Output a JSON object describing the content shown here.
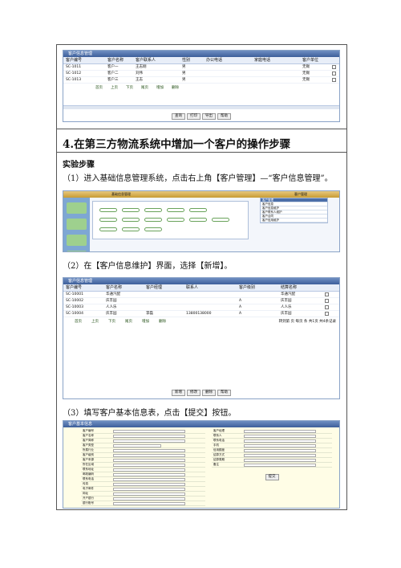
{
  "top_table": {
    "title": "客户信息管理",
    "headers": [
      "客户编号",
      "客户名称",
      "客户联系人",
      "性别",
      "办公电话",
      "家庭电话",
      "客户单位"
    ],
    "rows": [
      [
        "SC-1011",
        "客户一",
        "王志刚",
        "男",
        "",
        "",
        "无锡"
      ],
      [
        "SC-1012",
        "客户二",
        "刘伟",
        "男",
        "",
        "",
        "无锡"
      ],
      [
        "SC-1013",
        "客户三",
        "王志",
        "男",
        "",
        "",
        "无锡"
      ]
    ],
    "toolbar": [
      "首页",
      "上页",
      "下页",
      "尾页",
      "增加",
      "删除"
    ],
    "buttons": [
      "查询",
      "打印",
      "导出",
      "帮助"
    ]
  },
  "step_heading": "4.在第三方物流系统中增加一个客户的操作步骤",
  "experiment_title": "实验步骤",
  "step1": "（1）进入基础信息管理系统，点击右上角【客户管理】—“客户信息管理”。",
  "step2": "（2）在【客户信息维护】界面，选择【新增】。",
  "step3": "（3）填写客户基本信息表，点击【提交】按钮。",
  "screen1": {
    "title": "基础信息管理",
    "header_right": "客户管理",
    "menu_right": [
      "客户管理",
      "客户信息",
      "客户信息维护",
      "客户联系人维护",
      "客户合同",
      "客户信用维护"
    ]
  },
  "screen2": {
    "title": "客户信息管理",
    "headers": [
      "客户编号",
      "客户名称",
      "客户经理",
      "联系人",
      "客户级别",
      "结算名称"
    ],
    "rows": [
      [
        "SC-10001",
        "华通汽配",
        "",
        "",
        "",
        "华通汽配"
      ],
      [
        "SC-10002",
        "庆丰园",
        "",
        "",
        "A",
        "庆丰园"
      ],
      [
        "SC-10003",
        "人人乐",
        "",
        "",
        "A",
        "人人乐"
      ],
      [
        "SC-10004",
        "庆丰园",
        "李磊",
        "13800138000",
        "A",
        "庆丰园"
      ]
    ],
    "toolbar": [
      "首页",
      "上页",
      "下页",
      "尾页",
      "增加",
      "删除"
    ],
    "paging": "转到第 页 每页 条 共1页 共4条记录",
    "buttons": [
      "新增",
      "修改",
      "删除",
      "帮助"
    ]
  },
  "screen3": {
    "title": "客户基本信息",
    "fields_left": [
      "客户编号",
      "客户名称",
      "客户简称",
      "客户类型",
      "所属行业",
      "客户级别",
      "客户来源",
      "所在区域",
      "联系地址",
      "邮政编码",
      "联系电话",
      "传真",
      "电子邮件",
      "网址",
      "开户银行",
      "银行账号"
    ],
    "fields_right": [
      "客户经理",
      "联系人",
      "联系电话",
      "手机",
      "信用额度",
      "结算方式",
      "结算周期",
      "备注"
    ],
    "submit": "提交"
  }
}
